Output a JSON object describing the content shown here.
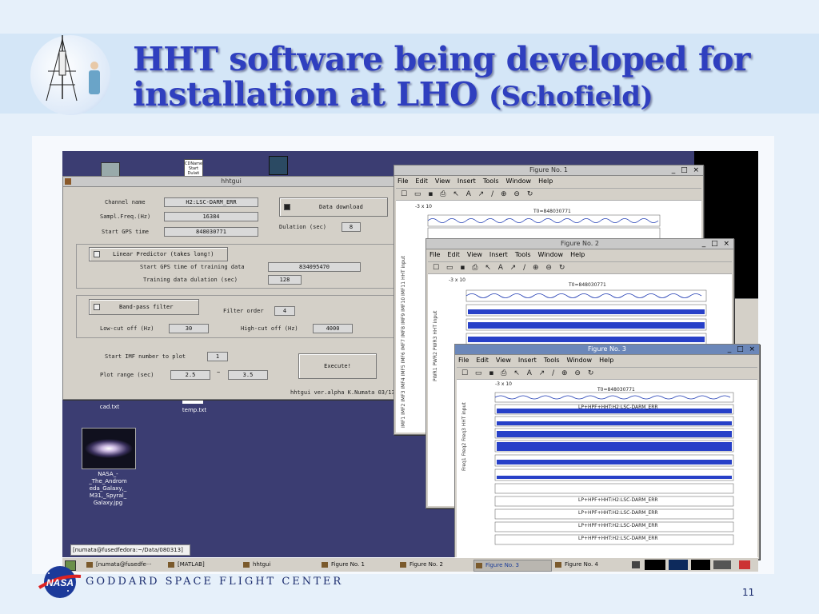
{
  "slide": {
    "title_line1": "HHT software being developed for",
    "title_line2_main": "installation at LHO ",
    "title_line2_small": "(Schofield)",
    "footer_center": "GODDARD SPACE FLIGHT CENTER",
    "page_number": "11",
    "colors": {
      "title": "#2f3fbf",
      "band": "#d4e6f7",
      "background": "#e6f0fa"
    }
  },
  "desktop": {
    "icons": [
      {
        "label": "cad.txt"
      },
      {
        "label": "temp.txt"
      },
      {
        "label": "NASA_-_The_Andromeda_Galaxy,_M31,_Spyral_Galaxy.jpg",
        "lines": [
          "NASA_-",
          "_The_Androm",
          "eda_Galaxy,_",
          "M31,_Spyral_",
          "Galaxy.jpg"
        ]
      }
    ],
    "top_icon_label_lines": [
      "CDName",
      "Start",
      "Dulati"
    ],
    "terminal_title": "[numata@fusedfedora:~/Data/080313]"
  },
  "hhtgui": {
    "title": "hhtgui",
    "channel_name_label": "Channel name",
    "channel_name_value": "H2:LSC-DARM_ERR",
    "sampl_freq_label": "Sampl.Freq.(Hz)",
    "sampl_freq_value": "16384",
    "start_gps_label": "Start GPS time",
    "start_gps_value": "848030771",
    "data_download_label": "Data download",
    "dulation_label": "Dulation (sec)",
    "dulation_value": "8",
    "linear_predictor_label": "Linear Predictor (takes long!)",
    "training_start_label": "Start GPS time of training data",
    "training_start_value": "834095470",
    "training_dulation_label": "Training data dulation (sec)",
    "training_dulation_value": "128",
    "bandpass_label": "Band-pass filter",
    "filter_order_label": "Filter order",
    "filter_order_value": "4",
    "lowcut_label": "Low-cut off (Hz)",
    "lowcut_value": "30",
    "highcut_label": "High-cut off (Hz)",
    "highcut_value": "4000",
    "start_imf_label": "Start IMF number to plot",
    "start_imf_value": "1",
    "plot_range_label": "Plot range (sec)",
    "plot_range_from": "2.5",
    "plot_range_sep": "~",
    "plot_range_to": "3.5",
    "execute_label": "Execute!",
    "version_text": "hhtgui ver.alpha K.Numata 03/13/"
  },
  "figure_menu": [
    "File",
    "Edit",
    "View",
    "Insert",
    "Tools",
    "Window",
    "Help"
  ],
  "figures": [
    {
      "title": "Figure No. 1",
      "t0": "T0=848030771",
      "exp": "-3 x 10",
      "ylabels": "IMF1 IMF2 IMF3 IMF4 IMF5 IMF6 IMF7 IMF8 IMF9 IMF10 IMF11 HHT input"
    },
    {
      "title": "Figure No. 2",
      "t0": "T0=848030771",
      "exp": "-3 x 10",
      "ylabels": "PWR1 PWR2 PWR3 HHT input"
    },
    {
      "title": "Figure No. 3",
      "t0": "T0=848030771",
      "exp": "-3 x 10",
      "ylabels": "Freq1 Freq2 Freq3 HHT input",
      "panel_labels": [
        "LP+HPF+HHT:H2:LSC-DARM_ERR",
        "LP+HPF+HHT:H2:LSC-DARM_ERR",
        "LP+HPF+HHT:H2:LSC-DARM_ERR",
        "LP+HPF+HHT:H2:LSC-DARM_ERR",
        "LP+HPF+HHT:H2:LSC-DARM_ERR"
      ]
    }
  ],
  "taskbar": {
    "items": [
      "[numata@fusedfe···",
      "[MATLAB]",
      "hhtgui",
      "Figure No. 1",
      "Figure No. 2",
      "Figure No. 3",
      "Figure No. 4"
    ]
  },
  "window_buttons": "_ □ ×"
}
